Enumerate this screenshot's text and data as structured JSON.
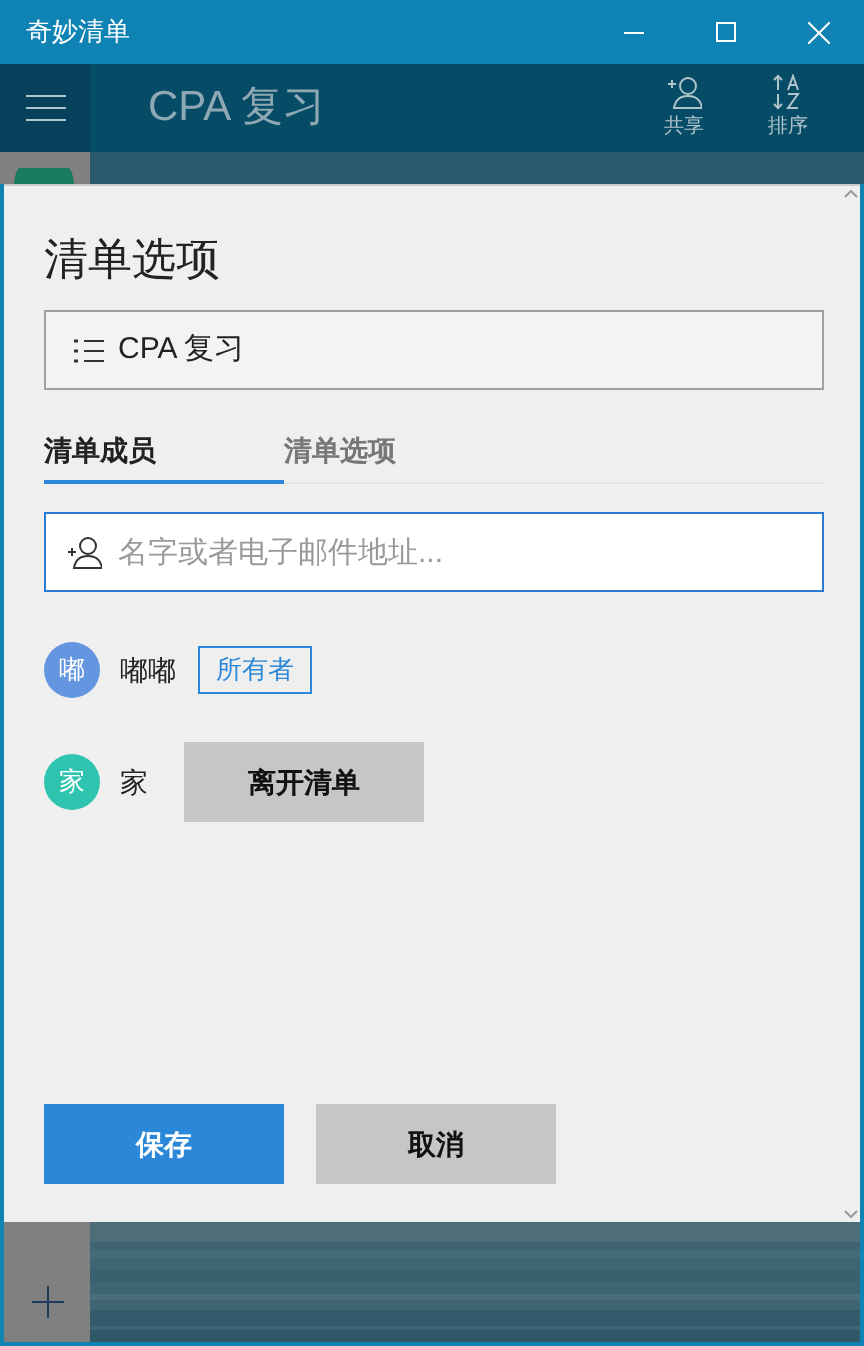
{
  "window": {
    "title": "奇妙清单"
  },
  "header": {
    "list_title": "CPA 复习",
    "actions": [
      {
        "label": "共享",
        "kind": "share"
      },
      {
        "label": "排序",
        "kind": "sort"
      }
    ]
  },
  "dialog": {
    "title": "清单选项",
    "list_name": "CPA 复习",
    "tabs": [
      {
        "label": "清单成员",
        "selected": true
      },
      {
        "label": "清单选项",
        "selected": false
      }
    ],
    "invite_field": {
      "placeholder": "名字或者电子邮件地址..."
    },
    "members": [
      {
        "avatar": "嘟",
        "name": "嘟嘟",
        "color": "#6495e0",
        "kind": "owner",
        "badge": "所有者"
      },
      {
        "avatar": "家",
        "name": "家",
        "color": "#2ec4b0",
        "kind": "member",
        "action": "离开清单"
      }
    ],
    "buttons": [
      {
        "label": "保存",
        "kind": "primary"
      },
      {
        "label": "取消",
        "kind": "secondary"
      }
    ]
  }
}
